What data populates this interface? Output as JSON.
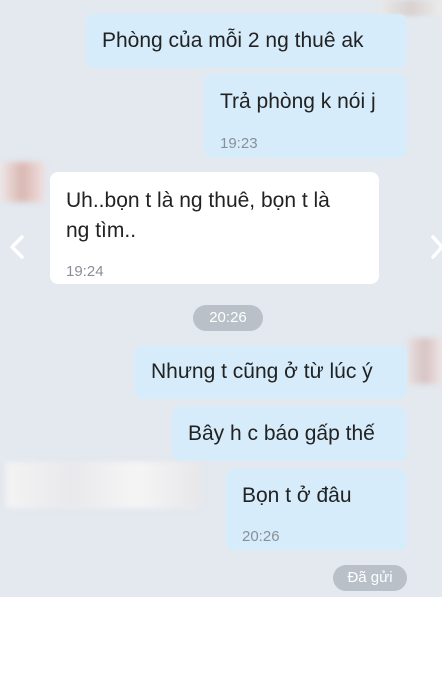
{
  "messages": [
    {
      "id": "m1",
      "direction": "outgoing",
      "text": "Phòng của mỗi 2 ng thuê ak",
      "time": ""
    },
    {
      "id": "m2",
      "direction": "outgoing",
      "text": "Trả phòng k nói j",
      "time": "19:23"
    },
    {
      "id": "m3",
      "direction": "incoming",
      "lines": [
        "Uh..bọn t là ng thuê, bọn t là",
        "ng tìm.."
      ],
      "time": "19:24"
    },
    {
      "id": "m4",
      "direction": "outgoing",
      "text": "Nhưng t cũng ở từ lúc ý",
      "time": ""
    },
    {
      "id": "m5",
      "direction": "outgoing",
      "text": "Bây h c báo gấp thế",
      "time": ""
    },
    {
      "id": "m6",
      "direction": "outgoing",
      "text": "Bọn t ở đâu",
      "time": "20:26"
    }
  ],
  "time_divider": "20:26",
  "sent_status": "Đã gửi",
  "icons": {
    "prev": "chevron-left-icon",
    "next": "chevron-right-icon"
  },
  "colors": {
    "background": "#e3e9ef",
    "outgoing_bubble": "#d6ecfb",
    "incoming_bubble": "#ffffff",
    "pill": "#b9c0c7"
  }
}
